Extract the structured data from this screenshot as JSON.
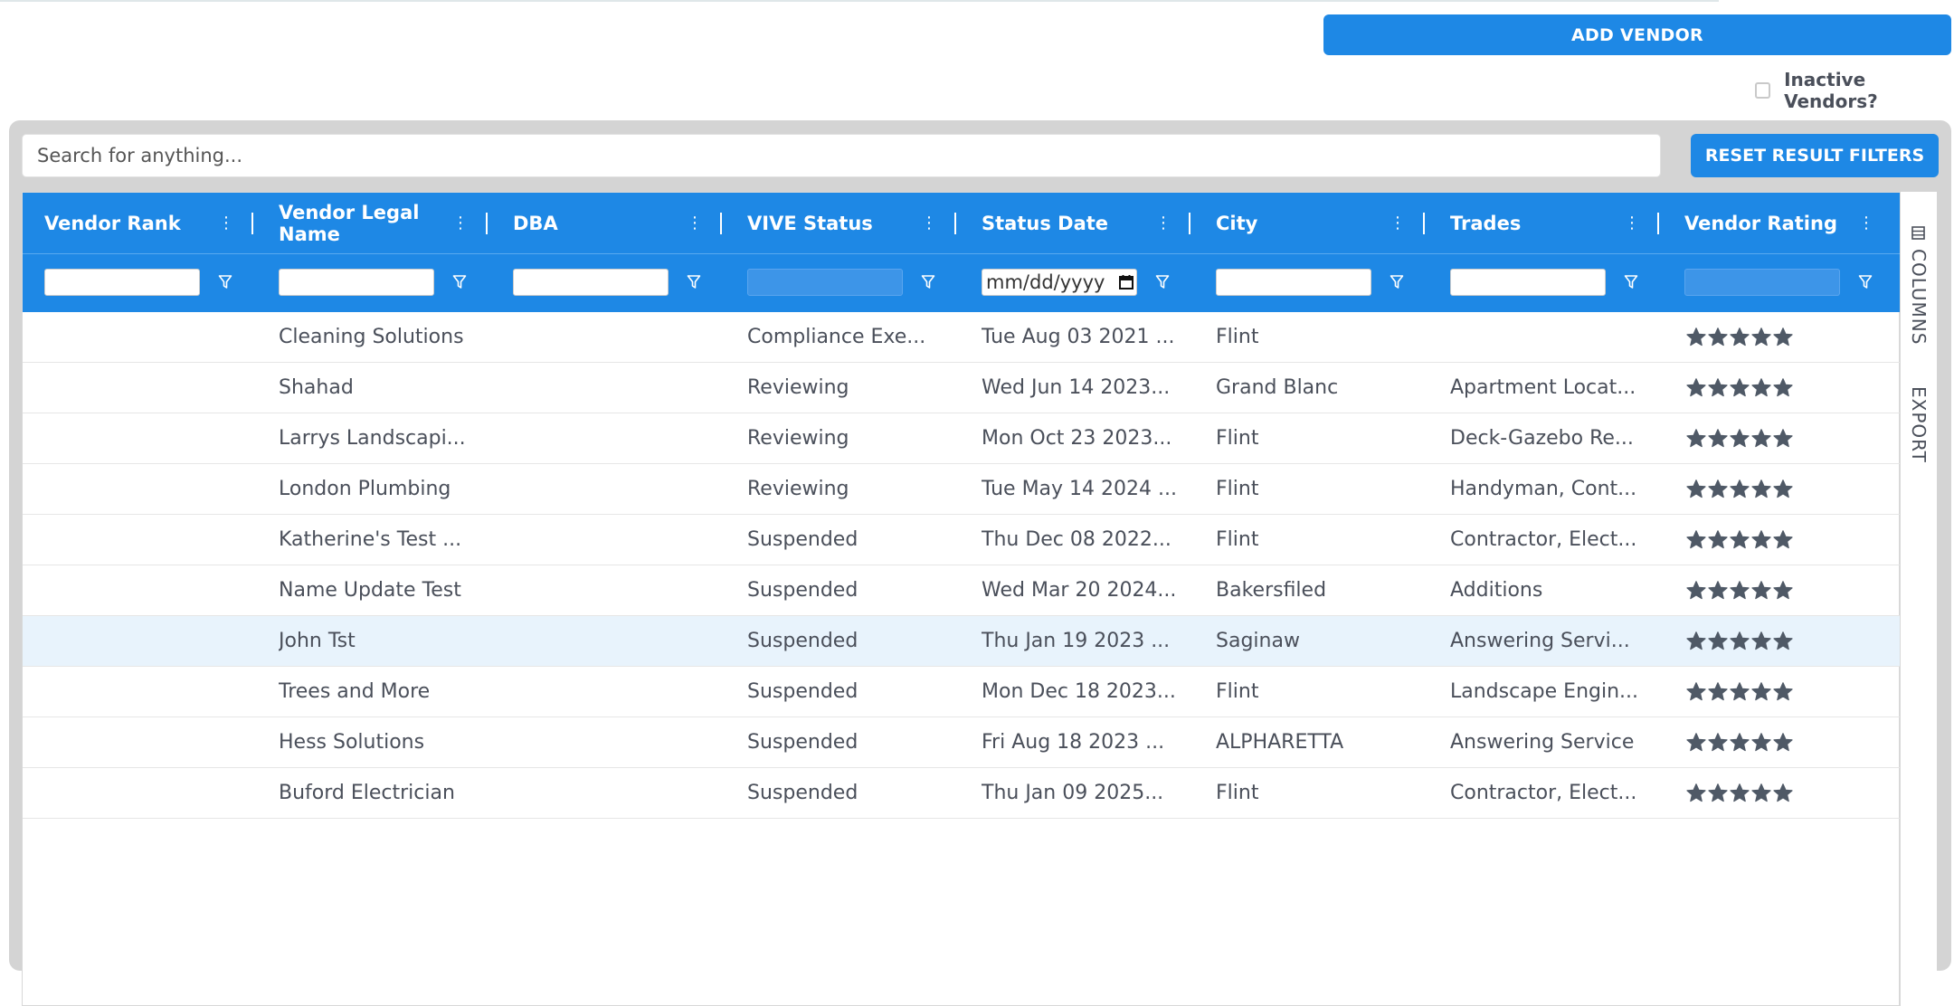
{
  "toolbar": {
    "add_vendor_label": "ADD VENDOR",
    "inactive_label": "Inactive Vendors?",
    "inactive_checked": false
  },
  "search": {
    "placeholder": "Search for anything...",
    "reset_label": "RESET RESULT FILTERS"
  },
  "grid": {
    "columns": [
      {
        "title": "Vendor Rank",
        "filter_value": "",
        "filter_enabled": true
      },
      {
        "title": "Vendor Legal Name",
        "filter_value": "",
        "filter_enabled": true
      },
      {
        "title": "DBA",
        "filter_value": "",
        "filter_enabled": true
      },
      {
        "title": "VIVE Status",
        "filter_value": "",
        "filter_enabled": false
      },
      {
        "title": "Status Date",
        "filter_value": "mm/dd/yyyy",
        "filter_enabled": true
      },
      {
        "title": "City",
        "filter_value": "",
        "filter_enabled": true
      },
      {
        "title": "Trades",
        "filter_value": "",
        "filter_enabled": true
      },
      {
        "title": "Vendor Rating",
        "filter_value": "",
        "filter_enabled": false
      }
    ],
    "rows": [
      {
        "rank": "",
        "name": "Cleaning Solutions",
        "dba": "",
        "status": "Compliance Exe...",
        "date": "Tue Aug 03 2021 ...",
        "city": "Flint",
        "trades": "",
        "rating": 5
      },
      {
        "rank": "",
        "name": "Shahad",
        "dba": "",
        "status": "Reviewing",
        "date": "Wed Jun 14 2023...",
        "city": "Grand Blanc",
        "trades": "Apartment Locat...",
        "rating": 5
      },
      {
        "rank": "",
        "name": "Larrys Landscapi...",
        "dba": "",
        "status": "Reviewing",
        "date": "Mon Oct 23 2023...",
        "city": "Flint",
        "trades": "Deck-Gazebo Re...",
        "rating": 5
      },
      {
        "rank": "",
        "name": "London Plumbing",
        "dba": "",
        "status": "Reviewing",
        "date": "Tue May 14 2024 ...",
        "city": "Flint",
        "trades": "Handyman, Cont...",
        "rating": 5
      },
      {
        "rank": "",
        "name": "Katherine's Test ...",
        "dba": "",
        "status": "Suspended",
        "date": "Thu Dec 08 2022...",
        "city": "Flint",
        "trades": "Contractor, Elect...",
        "rating": 5
      },
      {
        "rank": "",
        "name": "Name Update Test",
        "dba": "",
        "status": "Suspended",
        "date": "Wed Mar 20 2024...",
        "city": "Bakersfiled",
        "trades": "Additions",
        "rating": 5
      },
      {
        "rank": "",
        "name": "John Tst",
        "dba": "",
        "status": "Suspended",
        "date": "Thu Jan 19 2023 ...",
        "city": "Saginaw",
        "trades": "Answering Servi...",
        "rating": 5,
        "highlighted": true
      },
      {
        "rank": "",
        "name": "Trees and More",
        "dba": "",
        "status": "Suspended",
        "date": "Mon Dec 18 2023...",
        "city": "Flint",
        "trades": "Landscape Engin...",
        "rating": 5
      },
      {
        "rank": "",
        "name": "Hess Solutions",
        "dba": "",
        "status": "Suspended",
        "date": "Fri Aug 18 2023 ...",
        "city": "ALPHARETTA",
        "trades": "Answering Service",
        "rating": 5
      },
      {
        "rank": "",
        "name": "Buford Electrician",
        "dba": "",
        "status": "Suspended",
        "date": "Thu Jan 09 2025...",
        "city": "Flint",
        "trades": "Contractor, Elect...",
        "rating": 5
      }
    ]
  },
  "side_panel": {
    "columns_label": "COLUMNS",
    "export_label": "EXPORT"
  },
  "icons": {
    "column_menu": "vertical-dots-icon",
    "filter": "funnel-icon",
    "calendar": "calendar-icon",
    "rating": "star-icon",
    "columns_panel": "columns-icon"
  },
  "colors": {
    "primary": "#1e88e5",
    "star": "#4f5966",
    "row_highlight": "#e8f3fc",
    "panel_bg": "#d4d4d4"
  }
}
